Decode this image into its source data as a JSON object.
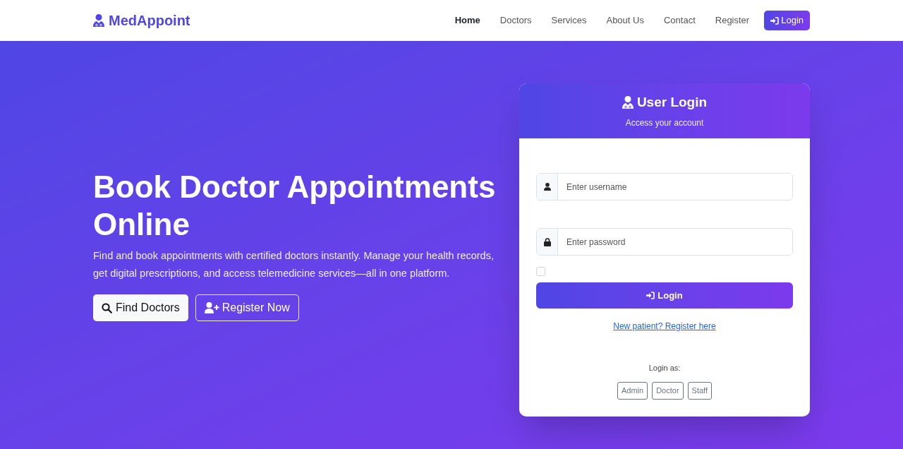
{
  "nav": {
    "brand": "MedAppoint",
    "links": [
      {
        "label": "Home",
        "selected": true
      },
      {
        "label": "Doctors",
        "selected": false
      },
      {
        "label": "Services",
        "selected": false
      },
      {
        "label": "About Us",
        "selected": false
      },
      {
        "label": "Contact",
        "selected": false
      },
      {
        "label": "Register",
        "selected": false
      }
    ],
    "login_button": "Login"
  },
  "hero": {
    "title": "Book Doctor Appointments Online",
    "description": "Find and book appointments with certified doctors instantly. Manage your health records, get digital prescriptions, and access telemedicine services—all in one platform.",
    "buttons": [
      {
        "label": "Find Doctors",
        "kind": "search"
      },
      {
        "label": "Register Now",
        "kind": "register"
      }
    ]
  },
  "login_card": {
    "title": "User Login",
    "subtitle": "Access your account",
    "fields": [
      {
        "kind": "username",
        "placeholder": "Enter username"
      },
      {
        "kind": "password",
        "placeholder": "Enter password"
      }
    ],
    "remember": {
      "checked": false
    },
    "submit": "Login",
    "register_link": "New patient? Register here",
    "login_as": {
      "label": "Login as:",
      "options": [
        "Admin",
        "Doctor",
        "Staff"
      ]
    }
  }
}
